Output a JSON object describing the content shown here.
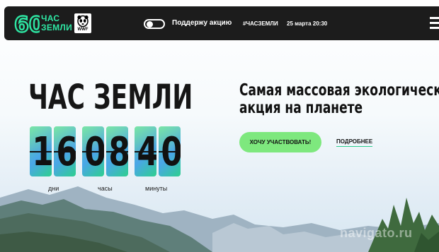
{
  "header": {
    "logo_number": "60",
    "logo_line1": "ЧАС",
    "logo_line2": "ЗЕМЛИ",
    "partner_logo": "WWF",
    "support_label": "Поддержу акцию",
    "hashtag": "#ЧАСЗЕМЛИ",
    "event_date": "25 марта 20:30"
  },
  "hero": {
    "title": "ЧАС ЗЕМЛИ",
    "headline_line1": "Самая массовая экологическая",
    "headline_line2": "акция на планете",
    "cta_label": "ХОЧУ УЧАСТВОВАТЬ!",
    "more_label": "ПОДРОБНЕЕ"
  },
  "countdown": {
    "days": [
      "1",
      "6"
    ],
    "hours": [
      "0",
      "8"
    ],
    "minutes": [
      "4",
      "0"
    ],
    "days_label": "дни",
    "hours_label": "часы",
    "minutes_label": "минуты"
  },
  "watermark": "navigato.ru",
  "colors": {
    "accent_green": "#2ee6a3",
    "header_bg": "#1c1c1c",
    "cta_bg": "#7ee87e"
  },
  "icons": {
    "menu": "hamburger-icon",
    "toggle": "toggle-switch",
    "partner": "panda-icon"
  }
}
